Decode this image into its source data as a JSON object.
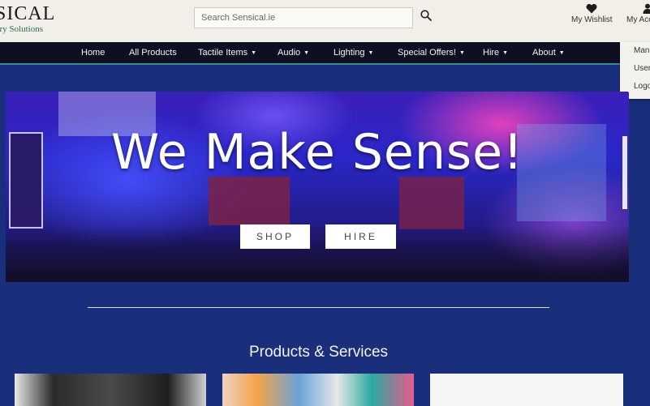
{
  "header": {
    "logo_text": "SICAL",
    "logo_tagline": "ory Solutions",
    "search_placeholder": "Search Sensical.ie",
    "wishlist_label": "My Wishlist",
    "account_label": "My Acc"
  },
  "account_dropdown": [
    "Man",
    "User",
    "Logo"
  ],
  "nav": [
    {
      "label": "Home",
      "dropdown": false
    },
    {
      "label": "All Products",
      "dropdown": false
    },
    {
      "label": "Tactile Items",
      "dropdown": true
    },
    {
      "label": "Audio",
      "dropdown": true
    },
    {
      "label": "Lighting",
      "dropdown": true
    },
    {
      "label": "Special Offers!",
      "dropdown": true
    },
    {
      "label": "Hire",
      "dropdown": true
    },
    {
      "label": "About",
      "dropdown": true
    }
  ],
  "hero": {
    "title": "We Make Sense!",
    "shop_button": "SHOP",
    "hire_button": "HIRE"
  },
  "section": {
    "title": "Products & Services"
  },
  "icons": {
    "search": "search-icon",
    "wishlist": "heart-icon",
    "account": "user-icon",
    "caret": "chevron-down-icon"
  },
  "colors": {
    "header_bg": "#f1efe8",
    "nav_bg": "#0c1020",
    "nav_accent": "#3b8d8e",
    "page_bg": "#1a2f7c"
  }
}
